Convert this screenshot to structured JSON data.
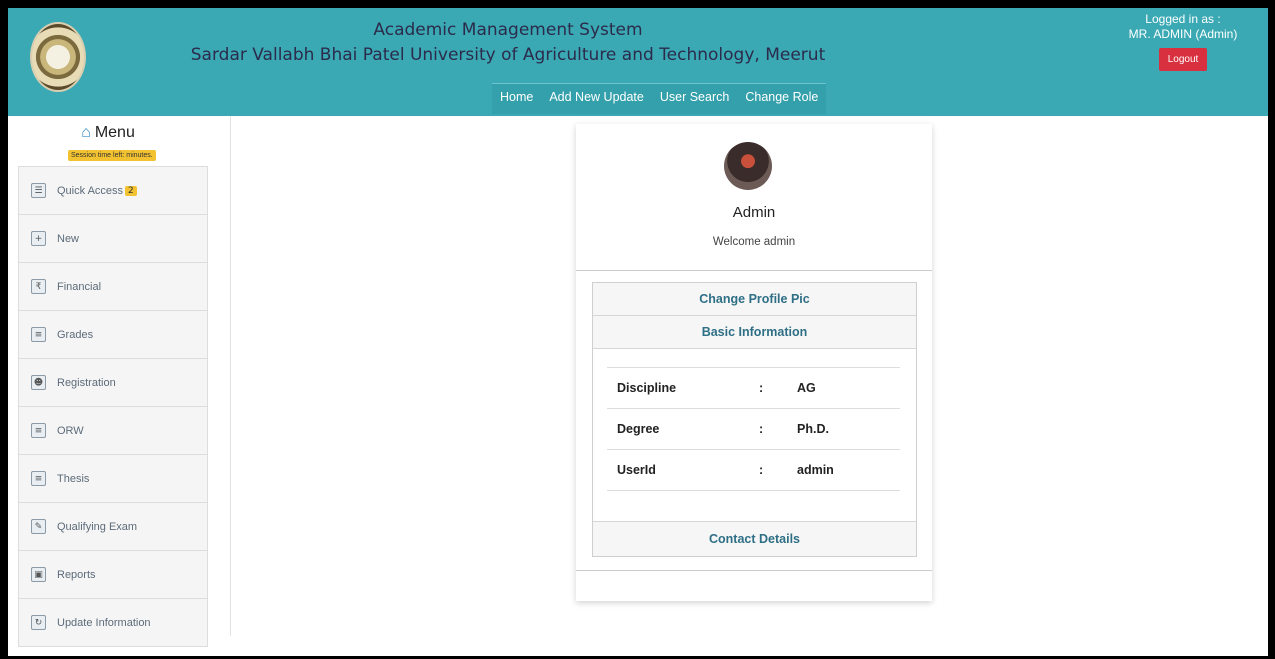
{
  "header": {
    "title": "Academic Management System",
    "subtitle": "Sardar Vallabh Bhai Patel University of Agriculture and Technology, Meerut",
    "nav": [
      "Home",
      "Add New Update",
      "User Search",
      "Change Role"
    ],
    "logged_in_label": "Logged in as :",
    "user": "MR. ADMIN (Admin)",
    "logout_label": "Logout",
    "color": "#3aa9b4"
  },
  "sidebar": {
    "title": "Menu",
    "session_text": "Session time left: minutes.",
    "items": [
      {
        "label": "Quick Access",
        "icon": "quick-access-icon",
        "badge": "2"
      },
      {
        "label": "New",
        "icon": "new-icon"
      },
      {
        "label": "Financial",
        "icon": "financial-icon"
      },
      {
        "label": "Grades",
        "icon": "grades-icon"
      },
      {
        "label": "Registration",
        "icon": "registration-icon"
      },
      {
        "label": "ORW",
        "icon": "orw-icon"
      },
      {
        "label": "Thesis",
        "icon": "thesis-icon"
      },
      {
        "label": "Qualifying Exam",
        "icon": "qualifying-exam-icon"
      },
      {
        "label": "Reports",
        "icon": "reports-icon"
      },
      {
        "label": "Update Information",
        "icon": "update-information-icon"
      }
    ]
  },
  "profile": {
    "name": "Admin",
    "welcome": "Welcome admin",
    "change_pic_label": "Change Profile Pic",
    "basic_info_label": "Basic Information",
    "fields": [
      {
        "key": "Discipline",
        "sep": ":",
        "value": "AG"
      },
      {
        "key": "Degree",
        "sep": ":",
        "value": "Ph.D."
      },
      {
        "key": "UserId",
        "sep": ":",
        "value": "admin"
      }
    ],
    "contact_label": "Contact Details"
  }
}
